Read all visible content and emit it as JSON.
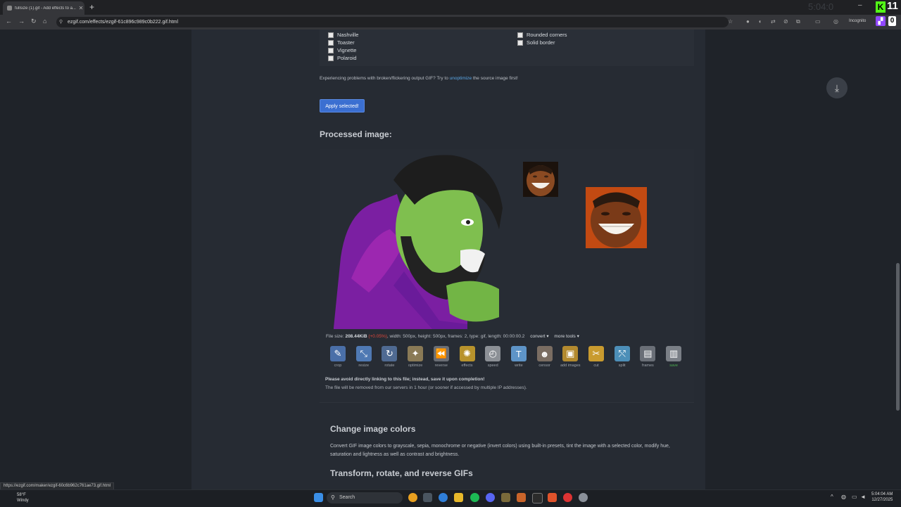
{
  "browser": {
    "tab_title": "fullsize (1).gif - Add effects to a...",
    "url": "ezgif.com/effects/ezgif-61c896c989c0b222.gif.html",
    "incognito_label": "Incognito",
    "overlay_kick_count": "11",
    "overlay_zero": "0"
  },
  "effects": {
    "left_options": [
      "Nashville",
      "Toaster",
      "Vignette",
      "Polaroid"
    ],
    "right_options": [
      "Rounded corners",
      "Solid border"
    ],
    "hint_before": "Experiencing problems with broken/flickering output GIF? Try to ",
    "hint_link": "unoptimize",
    "hint_after": " the source image first!",
    "apply_label": "Apply selected!"
  },
  "processed": {
    "heading": "Processed image:",
    "file_size_label": "File size: ",
    "file_size_value": "208.44KiB",
    "file_size_delta": "(+0.05%)",
    "details": ", width: 500px, height: 500px, frames: 2, type: gif, length: 00:00:00.2",
    "convert_label": "convert ▾",
    "more_tools_label": "more tools ▾",
    "tools": [
      {
        "label": "crop",
        "icon": "crop-icon",
        "color": "#4a6fa8",
        "glyph": "✎"
      },
      {
        "label": "resize",
        "icon": "resize-icon",
        "color": "#4f79b3",
        "glyph": "⤡"
      },
      {
        "label": "rotate",
        "icon": "rotate-icon",
        "color": "#4f6a92",
        "glyph": "↻"
      },
      {
        "label": "optimize",
        "icon": "optimize-icon",
        "color": "#8a7a56",
        "glyph": "✦"
      },
      {
        "label": "reverse",
        "icon": "reverse-icon",
        "color": "#6a6e75",
        "glyph": "⏪"
      },
      {
        "label": "effects",
        "icon": "effects-icon",
        "color": "#b8932c",
        "glyph": "✺"
      },
      {
        "label": "speed",
        "icon": "speed-icon",
        "color": "#8c9096",
        "glyph": "◴"
      },
      {
        "label": "write",
        "icon": "write-icon",
        "color": "#5e94c7",
        "glyph": "T"
      },
      {
        "label": "censor",
        "icon": "censor-icon",
        "color": "#7a6d62",
        "glyph": "☻"
      },
      {
        "label": "add images",
        "icon": "add-images-icon",
        "color": "#b38a2f",
        "glyph": "▣"
      },
      {
        "label": "cut",
        "icon": "cut-icon",
        "color": "#c99b2f",
        "glyph": "✂"
      },
      {
        "label": "split",
        "icon": "split-icon",
        "color": "#4d8fb8",
        "glyph": "⤲"
      },
      {
        "label": "frames",
        "icon": "frames-icon",
        "color": "#6a6f77",
        "glyph": "▤"
      },
      {
        "label": "save",
        "icon": "save-icon",
        "color": "#7a7f86",
        "glyph": "▥"
      }
    ],
    "warning_bold": "Please avoid directly linking to this file; instead, save it upon completion!",
    "warning_text": "The file will be removed from our servers in 1 hour (or sooner if accessed by multiple IP addresses)."
  },
  "info": {
    "h1": "Change image colors",
    "p1": "Convert GIF image colors to grayscale, sepia, monochrome or negative (invert colors) using built-in presets, tint the image with a selected color, modify hue, saturation and lightness as well as contrast and brightness.",
    "h2": "Transform, rotate, and reverse GIFs"
  },
  "status_url": "https://ezgif.com/maker/ezgif-60c6b962c761ae73.gif.html",
  "taskbar": {
    "weather_temp": "58°F",
    "weather_desc": "Windy",
    "search_label": "Search",
    "time": "5:04:04 AM",
    "date": "12/27/2025"
  }
}
